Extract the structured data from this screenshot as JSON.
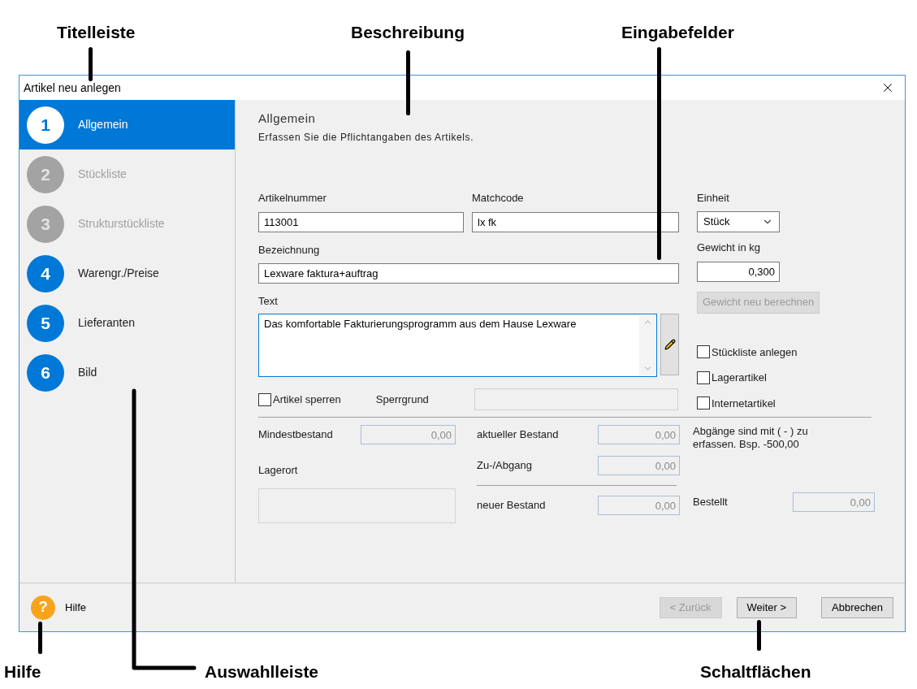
{
  "annotations": [
    {
      "label": "Titelleiste"
    },
    {
      "label": "Beschreibung"
    },
    {
      "label": "Eingabefelder"
    },
    {
      "label": "Hilfe"
    },
    {
      "label": "Auswahlleiste"
    },
    {
      "label": "Schaltflächen"
    }
  ],
  "window": {
    "title": "Artikel neu anlegen"
  },
  "steps": [
    {
      "number": "1",
      "label": "Allgemein",
      "selected": true,
      "disabled": false
    },
    {
      "number": "2",
      "label": "Stückliste",
      "selected": false,
      "disabled": true
    },
    {
      "number": "3",
      "label": "Strukturstückliste",
      "selected": false,
      "disabled": true
    },
    {
      "number": "4",
      "label": "Warengr./Preise",
      "selected": false,
      "disabled": false
    },
    {
      "number": "5",
      "label": "Lieferanten",
      "selected": false,
      "disabled": false
    },
    {
      "number": "6",
      "label": "Bild",
      "selected": false,
      "disabled": false
    }
  ],
  "header": {
    "title": "Allgemein",
    "description": "Erfassen Sie die Pflichtangaben des Artikels."
  },
  "artikelnummer": {
    "label": "Artikelnummer",
    "value": "113001"
  },
  "matchcode": {
    "label": "Matchcode",
    "value": "lx fk"
  },
  "bezeichnung": {
    "label": "Bezeichnung",
    "value": "Lexware faktura+auftrag"
  },
  "text": {
    "label": "Text",
    "value": "Das komfortable Fakturierungsprogramm aus dem Hause Lexware"
  },
  "einheit": {
    "label": "Einheit",
    "value": "Stück"
  },
  "gewicht": {
    "label": "Gewicht in kg",
    "value": "0,300"
  },
  "recalc_button": {
    "label": "Gewicht neu berechnen",
    "disabled": true
  },
  "options": [
    {
      "label": "Stückliste anlegen",
      "checked": false
    },
    {
      "label": "Lagerartikel",
      "checked": false
    },
    {
      "label": "Internetartikel",
      "checked": false
    }
  ],
  "artikel_sperren": {
    "label": "Artikel sperren",
    "checked": false
  },
  "sperrgrund": {
    "label": "Sperrgrund",
    "disabled": true
  },
  "mindestbestand": {
    "label": "Mindestbestand",
    "value": "0,00"
  },
  "lagerort": {
    "label": "Lagerort"
  },
  "aktueller_bestand": {
    "label": "aktueller Bestand",
    "value": "0,00"
  },
  "zu_abgang": {
    "label": "Zu-/Abgang",
    "value": "0,00"
  },
  "neuer_bestand": {
    "label": "neuer Bestand",
    "value": "0,00"
  },
  "bestellt": {
    "label": "Bestellt",
    "value": "0,00"
  },
  "note": "Abgänge sind mit ( - ) zu erfassen. Bsp. -500,00",
  "footer": {
    "help_icon": "?",
    "help": "Hilfe",
    "buttons": [
      {
        "label": "< Zurück",
        "disabled": true
      },
      {
        "label": "Weiter >",
        "disabled": false
      },
      {
        "label": "Abbrechen",
        "disabled": false
      }
    ]
  }
}
